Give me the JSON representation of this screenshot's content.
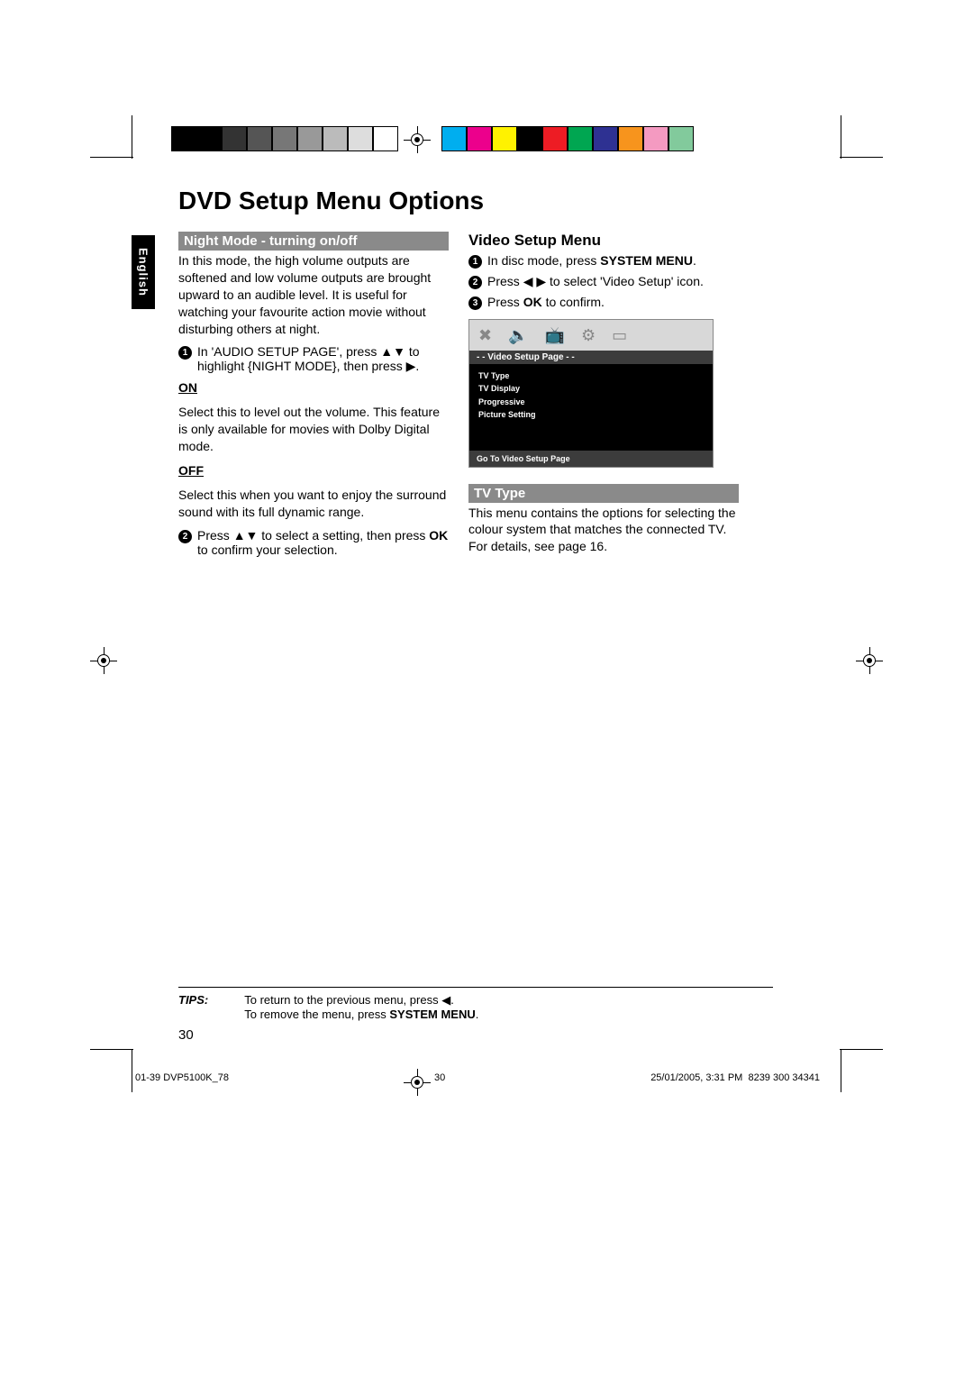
{
  "language_tab": "English",
  "heading": "DVD Setup Menu Options",
  "left_col": {
    "bar": "Night Mode - turning on/off",
    "intro": "In this mode, the high volume outputs are softened and low volume outputs are brought upward to an audible level. It is useful for watching your favourite action movie without disturbing others at night.",
    "step1_a": "In 'AUDIO SETUP PAGE', press ",
    "step1_b": " to highlight {NIGHT MODE}, then press ",
    "on_label": "ON",
    "on_text": "Select this to level out the volume. This feature is only available for movies with Dolby Digital mode.",
    "off_label": "OFF",
    "off_text": "Select this when you want to enjoy the surround sound with its full dynamic range.",
    "step2_a": "Press ",
    "step2_b": " to select a setting, then press ",
    "step2_ok": "OK",
    "step2_c": " to confirm your selection."
  },
  "right_col": {
    "header": "Video Setup Menu",
    "step1_a": "In disc mode, press ",
    "step1_b": "SYSTEM MENU",
    "step1_c": ".",
    "step2_a": "Press ",
    "step2_b": " to select 'Video Setup' icon.",
    "step3_a": "Press ",
    "step3_ok": "OK",
    "step3_b": " to confirm.",
    "osd": {
      "title": "- -   Video Setup Page   - -",
      "items": [
        "TV Type",
        "TV Display",
        "Progressive",
        "Picture Setting"
      ],
      "foot": "Go To Video Setup Page"
    },
    "tvtype_bar": "TV Type",
    "tvtype_text": "This menu contains the options for selecting the colour system that matches the connected TV.  For details, see page 16."
  },
  "tips": {
    "label": "TIPS:",
    "line1_a": "To return to the previous menu, press ",
    "line1_arrow": "◀",
    "line1_b": ".",
    "line2_a": "To remove the menu, press ",
    "line2_b": "SYSTEM MENU",
    "line2_c": "."
  },
  "page_number": "30",
  "imposition": {
    "file": "01-39 DVP5100K_78",
    "sheet": "30",
    "date": "25/01/2005, 3:31 PM",
    "code": "8239 300 34341"
  },
  "colorbar_left": [
    "#000",
    "#000",
    "#333",
    "#555",
    "#777",
    "#999",
    "#bbb",
    "#ddd",
    "#fff"
  ],
  "colorbar_right": [
    "#00aeef",
    "#ec008c",
    "#fff200",
    "#000",
    "#ed1c24",
    "#00a651",
    "#2e3192",
    "#f7941d",
    "#f49ac1",
    "#82ca9c"
  ]
}
